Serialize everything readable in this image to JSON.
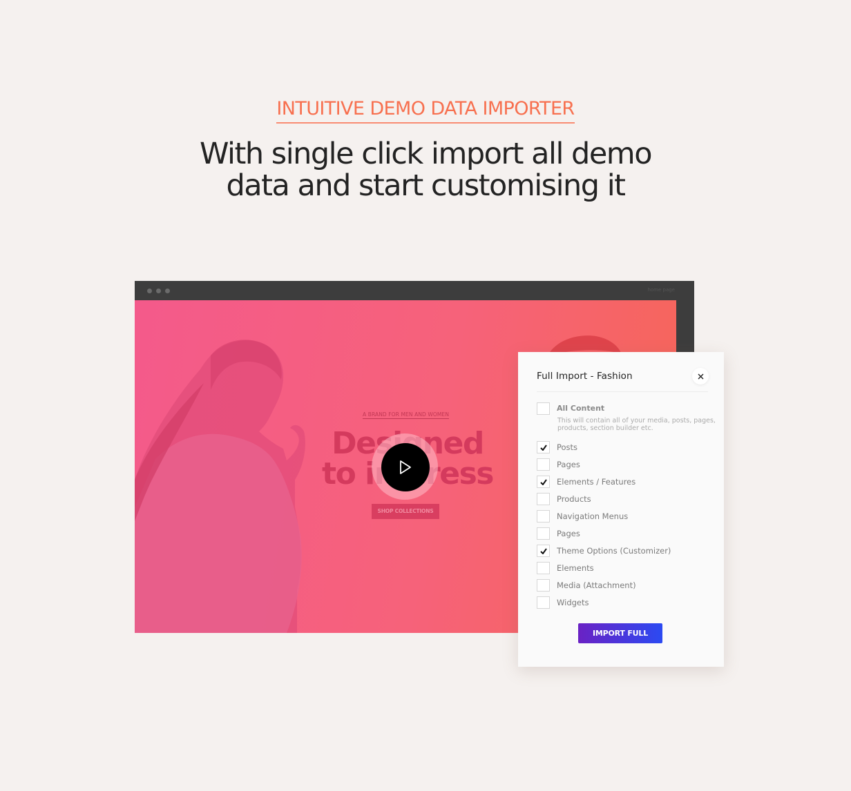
{
  "eyebrow": "INTUITIVE DEMO DATA IMPORTER",
  "headline": {
    "line1": "With single click import all demo",
    "line2": "data and start customising it"
  },
  "colors": {
    "accent": "#f7704f",
    "background": "#f5f1ef",
    "browser_frame": "#3d3d3d",
    "hero_gradient_start": "#f45a8b",
    "hero_gradient_end": "#f66657",
    "button_gradient_start": "#6a22c4",
    "button_gradient_end": "#2b4af2"
  },
  "browser": {
    "url_label": "home page",
    "hero": {
      "brand_tag": "A BRAND FOR MEN AND WOMEN",
      "title_line1": "Designed",
      "title_line2": "to impress",
      "cta_label": "SHOP COLLECTIONS",
      "play_icon": "play-icon"
    }
  },
  "modal": {
    "title": "Full Import - Fashion",
    "close_icon": "close-icon",
    "options": [
      {
        "label": "All Content",
        "checked": false,
        "description": "This will contain all of your media, posts, pages, products, section builder etc."
      },
      {
        "label": "Posts",
        "checked": true
      },
      {
        "label": "Pages",
        "checked": false
      },
      {
        "label": "Elements / Features",
        "checked": true
      },
      {
        "label": "Products",
        "checked": false
      },
      {
        "label": "Navigation Menus",
        "checked": false
      },
      {
        "label": "Pages",
        "checked": false
      },
      {
        "label": "Theme Options (Customizer)",
        "checked": true
      },
      {
        "label": "Elements",
        "checked": false
      },
      {
        "label": "Media (Attachment)",
        "checked": false
      },
      {
        "label": "Widgets",
        "checked": false
      }
    ],
    "import_button": "IMPORT FULL"
  }
}
